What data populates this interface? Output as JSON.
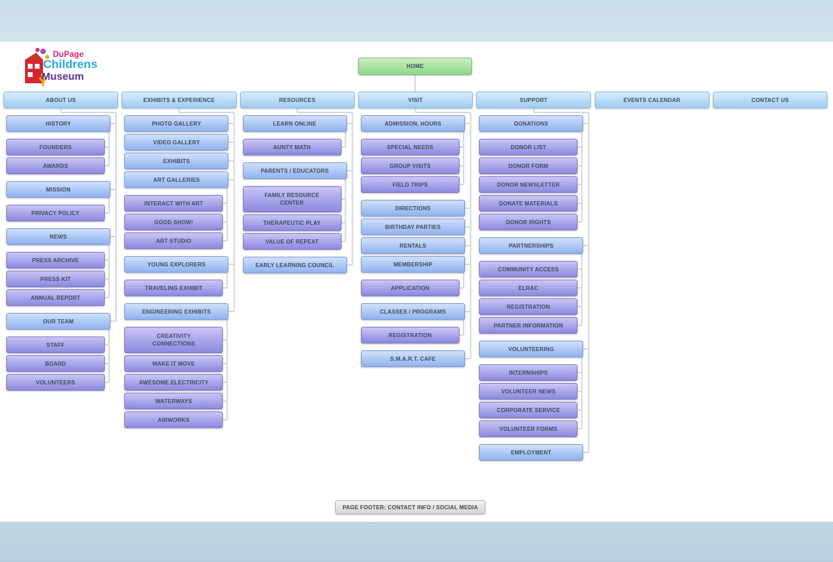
{
  "logo": {
    "line1": "DuPage",
    "line2": "Childrens",
    "line3": "Museum"
  },
  "home": "HOME",
  "footer": "PAGE FOOTER: CONTACT INFO / SOCIAL MEDIA",
  "nav": [
    {
      "label": "ABOUT US",
      "children": [
        {
          "label": "HISTORY",
          "children": [
            "FOUNDERS",
            "AWARDS"
          ]
        },
        {
          "label": "MISSION",
          "children": [
            "PRIVACY POLICY"
          ]
        },
        {
          "label": "NEWS",
          "children": [
            "PRESS ARCHIVE",
            "PRESS KIT",
            "ANNUAL REPORT"
          ]
        },
        {
          "label": "OUR TEAM",
          "children": [
            "STAFF",
            "BOARD",
            "VOLUNTEERS"
          ]
        }
      ]
    },
    {
      "label": "EXHIBITS & EXPERIENCE",
      "children": [
        {
          "label": "PHOTO GALLERY",
          "children": []
        },
        {
          "label": "VIDEO GALLERY",
          "children": []
        },
        {
          "label": "EXHIBITS",
          "children": []
        },
        {
          "label": "ART GALLERIES",
          "children": [
            "INTERACT WITH ART",
            "GOOD SHOW!",
            "ART STUDIO"
          ]
        },
        {
          "label": "YOUNG EXPLORERS",
          "children": [
            "TRAVELING EXHIBIT"
          ]
        },
        {
          "label": "ENGINEERING EXHIBITS",
          "children": [
            "CREATIVITY\nCONNECTIONS",
            "MAKE IT MOVE",
            "AWESOME ELECTRICITY",
            "WATERWAYS",
            "AIRWORKS"
          ]
        }
      ]
    },
    {
      "label": "RESOURCES",
      "children": [
        {
          "label": "LEARN ONLINE",
          "children": [
            "AUNTY MATH"
          ]
        },
        {
          "label": "PARENTS / EDUCATORS",
          "children": [
            "FAMILY RESOURCE\nCENTER",
            "THERAPEUTIC PLAY",
            "VALUE OF REPEAT"
          ]
        },
        {
          "label": "EARLY LEARNING COUNCIL",
          "children": []
        }
      ]
    },
    {
      "label": "VISIT",
      "children": [
        {
          "label": "ADMISSION, HOURS",
          "children": [
            "SPECIAL NEEDS",
            "GROUP VISITS",
            "FIELD TRIPS"
          ]
        },
        {
          "label": "DIRECTIONS",
          "children": []
        },
        {
          "label": "BIRTHDAY PARTIES",
          "children": []
        },
        {
          "label": "RENTALS",
          "children": []
        },
        {
          "label": "MEMBERSHIP",
          "children": [
            "APPLICATION"
          ]
        },
        {
          "label": "CLASSES / PROGRAMS",
          "children": [
            "REGISTRATION"
          ]
        },
        {
          "label": "S.M.A.R.T. CAFE",
          "children": []
        }
      ]
    },
    {
      "label": "SUPPORT",
      "children": [
        {
          "label": "DONATIONS",
          "children": [
            "DONOR LIST",
            "DONOR FORM",
            "DONOR NEWSLETTER",
            "DONATE MATERIALS",
            "DONOR RIGHTS"
          ]
        },
        {
          "label": "PARTNERSHIPS",
          "children": [
            "COMMUNITY ACCESS",
            "ELRAC",
            "REGISTRATION",
            "PARTNER INFORMATION"
          ]
        },
        {
          "label": "VOLUNTEERING",
          "children": [
            "INTERNSHIPS",
            "VOLUNTEER NEWS",
            "CORPORATE SERVICE",
            "VOLUNTEER FORMS"
          ]
        },
        {
          "label": "EMPLOYMENT",
          "children": []
        }
      ]
    },
    {
      "label": "EVENTS CALENDAR",
      "children": []
    },
    {
      "label": "CONTACT US",
      "children": []
    }
  ]
}
